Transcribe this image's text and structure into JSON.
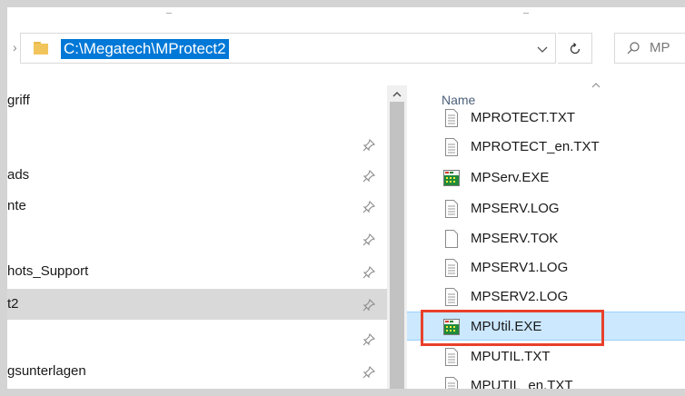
{
  "address_bar": {
    "path": "C:\\Megatech\\MProtect2"
  },
  "search": {
    "placeholder": "MP"
  },
  "navigation": {
    "items": [
      {
        "label": "griff",
        "pinned": false,
        "selected": false
      },
      {
        "label": "",
        "pinned": true,
        "selected": false
      },
      {
        "label": "ads",
        "pinned": true,
        "selected": false
      },
      {
        "label": "nte",
        "pinned": true,
        "selected": false
      },
      {
        "label": "",
        "pinned": true,
        "selected": false
      },
      {
        "label": "hots_Support",
        "pinned": true,
        "selected": false
      },
      {
        "label": "t2",
        "pinned": true,
        "selected": true
      },
      {
        "label": "",
        "pinned": true,
        "selected": false
      },
      {
        "label": "gsunterlagen",
        "pinned": true,
        "selected": false
      }
    ]
  },
  "file_list": {
    "column_header": "Name",
    "files": [
      {
        "name": "MPROTECT.TXT",
        "icon": "text-file-icon",
        "selected": false
      },
      {
        "name": "MPROTECT_en.TXT",
        "icon": "text-file-icon",
        "selected": false
      },
      {
        "name": "MPServ.EXE",
        "icon": "exe-app-icon",
        "selected": false
      },
      {
        "name": "MPSERV.LOG",
        "icon": "text-file-icon",
        "selected": false
      },
      {
        "name": "MPSERV.TOK",
        "icon": "blank-file-icon",
        "selected": false
      },
      {
        "name": "MPSERV1.LOG",
        "icon": "text-file-icon",
        "selected": false
      },
      {
        "name": "MPSERV2.LOG",
        "icon": "text-file-icon",
        "selected": false
      },
      {
        "name": "MPUtil.EXE",
        "icon": "exe-app-icon",
        "selected": true
      },
      {
        "name": "MPUTIL.TXT",
        "icon": "text-file-icon",
        "selected": false
      },
      {
        "name": "MPUTIL_en.TXT",
        "icon": "text-file-icon",
        "selected": false
      }
    ]
  },
  "colors": {
    "path_highlight": "#0078d7",
    "selected_row": "#cce8ff",
    "annotation_box": "#e8412c",
    "nav_selected": "#d9d9d9"
  }
}
